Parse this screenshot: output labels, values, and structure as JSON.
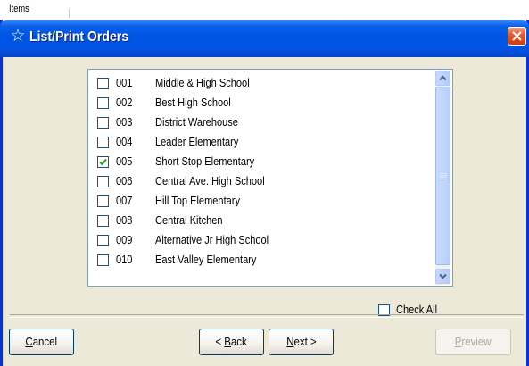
{
  "background": {
    "label": "Items"
  },
  "window": {
    "title": "List/Print Orders",
    "title_icon": "star-icon",
    "close_icon": "close-icon"
  },
  "list": {
    "items": [
      {
        "code": "001",
        "name": "Middle & High School",
        "checked": false
      },
      {
        "code": "002",
        "name": "Best High School",
        "checked": false
      },
      {
        "code": "003",
        "name": "District Warehouse",
        "checked": false
      },
      {
        "code": "004",
        "name": "Leader Elementary",
        "checked": false
      },
      {
        "code": "005",
        "name": "Short Stop Elementary",
        "checked": true
      },
      {
        "code": "006",
        "name": "Central Ave. High School",
        "checked": false
      },
      {
        "code": "007",
        "name": "Hill Top Elementary",
        "checked": false
      },
      {
        "code": "008",
        "name": "Central Kitchen",
        "checked": false
      },
      {
        "code": "009",
        "name": "Alternative Jr High School",
        "checked": false
      },
      {
        "code": "010",
        "name": "East Valley Elementary",
        "checked": false
      }
    ]
  },
  "check_all": {
    "label": "Check All",
    "checked": false
  },
  "buttons": {
    "cancel": {
      "label_first": "C",
      "label_rest": "ancel"
    },
    "back": {
      "label_prefix": "< ",
      "label_first": "B",
      "label_rest": "ack"
    },
    "next": {
      "label_first": "N",
      "label_rest": "ext >"
    },
    "preview": {
      "label_first": "P",
      "label_rest": "review",
      "enabled": false
    }
  },
  "colors": {
    "titlebar": "#0054e3",
    "dialog_bg": "#ece9d8",
    "close_button": "#e45a2c",
    "list_border": "#7f9db9",
    "scrollbar": "#b8cffb",
    "check": "#21a121"
  }
}
